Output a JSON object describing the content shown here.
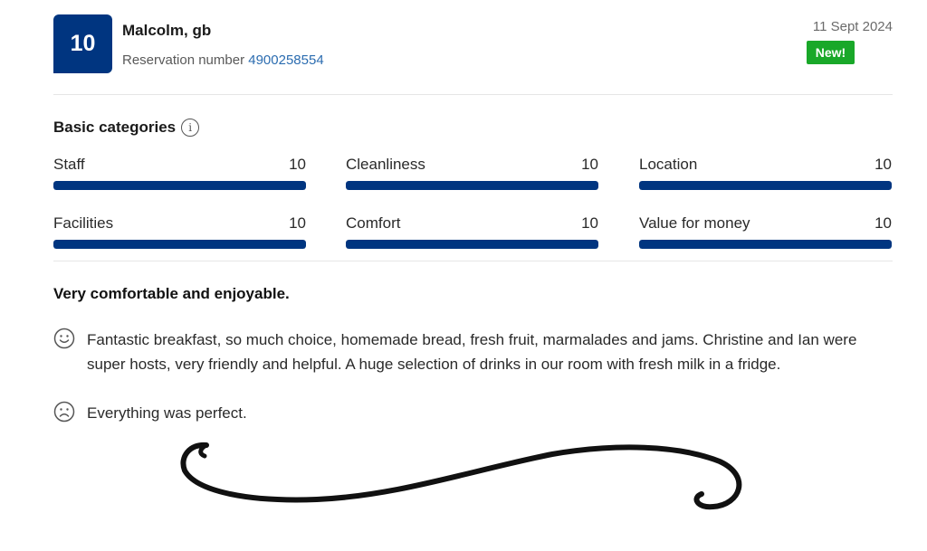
{
  "header": {
    "score": "10",
    "reviewer_name": "Malcolm, gb",
    "reservation_label": "Reservation number",
    "reservation_number": "4900258554",
    "date": "11 Sept 2024",
    "badge": "New!"
  },
  "categories": {
    "title": "Basic categories",
    "items": [
      {
        "label": "Staff",
        "score": "10",
        "fraction": 1.0
      },
      {
        "label": "Cleanliness",
        "score": "10",
        "fraction": 1.0
      },
      {
        "label": "Location",
        "score": "10",
        "fraction": 1.0
      },
      {
        "label": "Facilities",
        "score": "10",
        "fraction": 1.0
      },
      {
        "label": "Comfort",
        "score": "10",
        "fraction": 1.0
      },
      {
        "label": "Value for money",
        "score": "10",
        "fraction": 1.0
      }
    ]
  },
  "review": {
    "headline": "Very comfortable and enjoyable.",
    "positive": "Fantastic breakfast, so much choice, homemade bread, fresh fruit, marmalades and jams. Christine and Ian were super hosts, very friendly and helpful. A huge selection of drinks in our room with fresh milk in a fridge.",
    "negative": "Everything was perfect."
  },
  "colors": {
    "brand_blue": "#003580",
    "badge_green": "#19a829",
    "link_blue": "#2b6cb0"
  },
  "icons": {
    "info": "info-icon",
    "positive": "smiley-face-icon",
    "negative": "sad-face-icon"
  }
}
